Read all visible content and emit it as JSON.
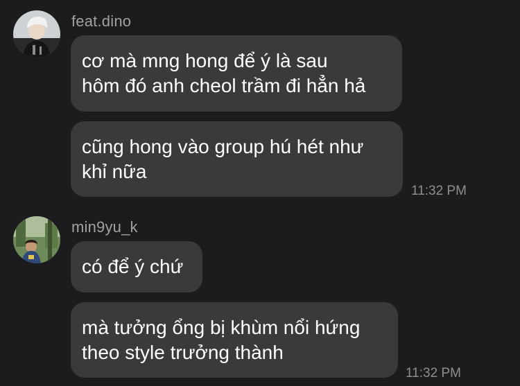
{
  "conversation": {
    "groups": [
      {
        "sender": "feat.dino",
        "avatar_icon": "user-avatar-icon",
        "messages": [
          {
            "text": "cơ mà mng hong để ý là sau\nhôm đó anh cheol trầm đi hẳn hả"
          },
          {
            "text": "cũng hong vào group hú hét như\nkhỉ nữa"
          }
        ],
        "timestamp": "11:32 PM"
      },
      {
        "sender": "min9yu_k",
        "avatar_icon": "user-avatar-icon",
        "messages": [
          {
            "text": "có để ý chứ"
          },
          {
            "text": "mà tưởng ổng bị khùm nổi hứng\ntheo style trưởng thành"
          }
        ],
        "timestamp": "11:32 PM"
      }
    ]
  },
  "colors": {
    "background": "#1c1c1e",
    "bubble": "#3a3a3c",
    "sender_text": "#a1a1a6",
    "timestamp_text": "#8e8e93"
  }
}
